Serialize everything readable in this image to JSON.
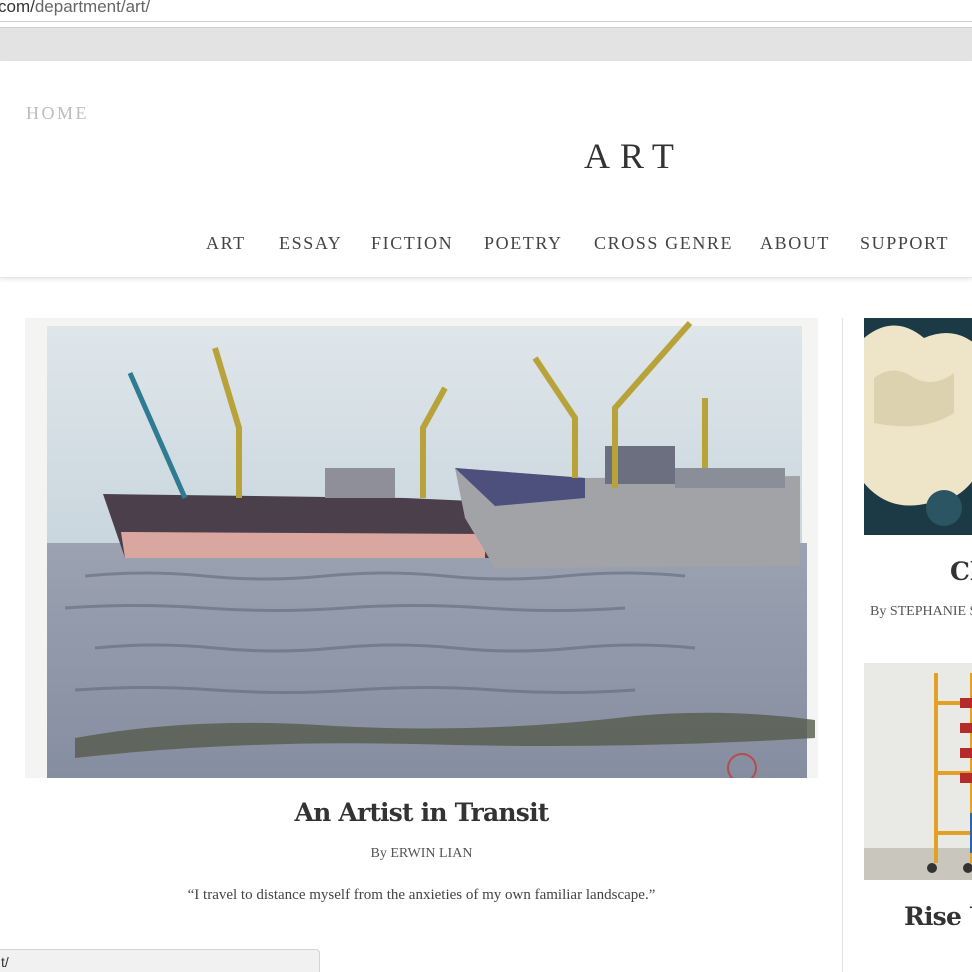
{
  "browser": {
    "url_prefix": "com/",
    "url_path": "department/art/",
    "status_url": "t/"
  },
  "header": {
    "home_label": "HOME",
    "page_title": "ART",
    "nav": [
      "ART",
      "ESSAY",
      "FICTION",
      "POETRY",
      "CROSS GENRE",
      "ABOUT",
      "SUPPORT"
    ]
  },
  "feature": {
    "title": "An Artist in Transit",
    "byline": "By ERWIN LIAN",
    "excerpt": "“I travel to distance myself from the anxieties of my own familiar landscape.”"
  },
  "sidebar": {
    "items": [
      {
        "title": "Cl",
        "byline": "By STEPHANIE S"
      },
      {
        "title": "Rise U"
      }
    ]
  },
  "colors": {
    "text": "#333333",
    "home_link": "#bdbdbd",
    "bookmark_strip": "#e3e3e3"
  }
}
